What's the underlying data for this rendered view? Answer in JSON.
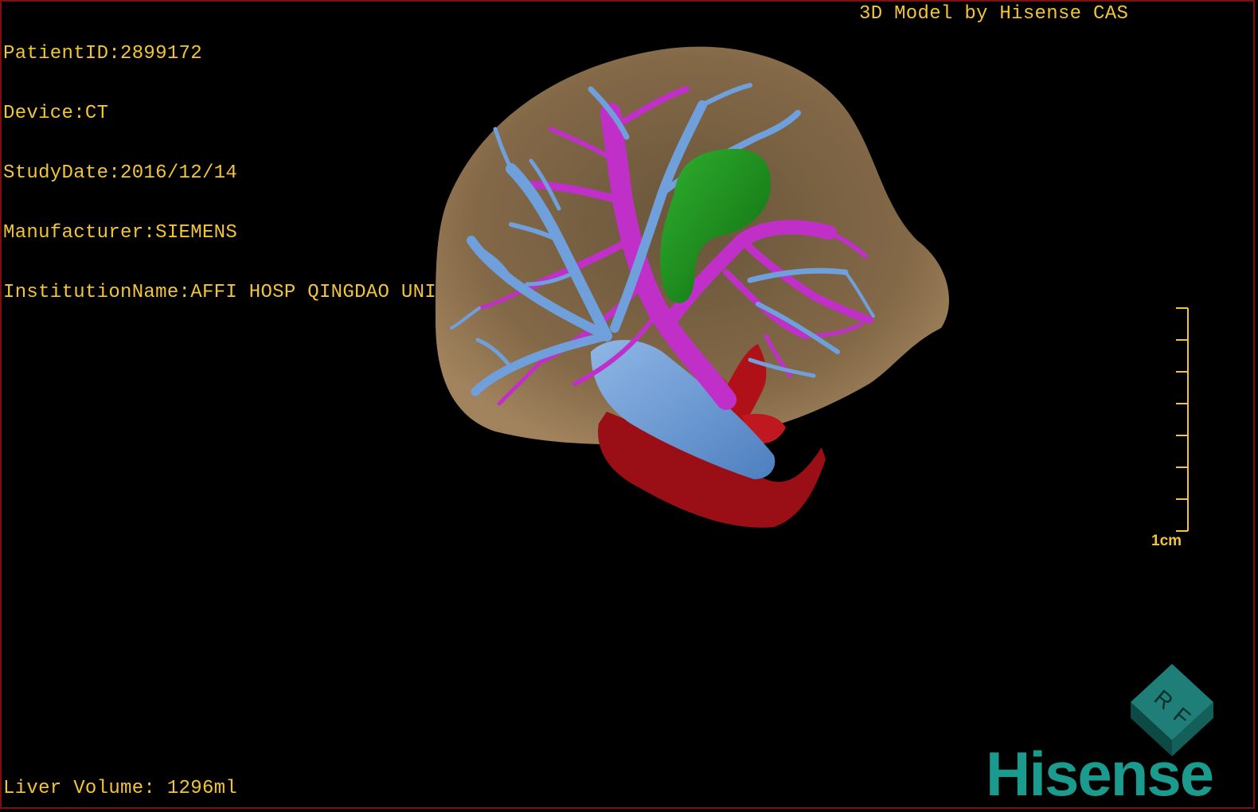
{
  "viewer": {
    "patient_lines": [
      "PatientID:2899172",
      "Device:CT",
      "StudyDate:2016/12/14",
      "Manufacturer:SIEMENS",
      "InstitutionName:AFFI HOSP QINGDAO UNI"
    ],
    "credit": "3D Model by Hisense CAS",
    "liver_volume": "Liver Volume: 1296ml",
    "scale_label": "1cm",
    "orientation_labels": [
      "R",
      "F"
    ],
    "brand": "Hisense"
  },
  "colors": {
    "overlay_text": "#f2c43a",
    "liver": "#8a6e4b",
    "portal_vein": "#c030c8",
    "hepatic_vein": "#6fa0dc",
    "artery": "#b01018",
    "gallbladder": "#1f8f1f",
    "brand": "#1a9b8e",
    "frame": "#7a1010"
  }
}
